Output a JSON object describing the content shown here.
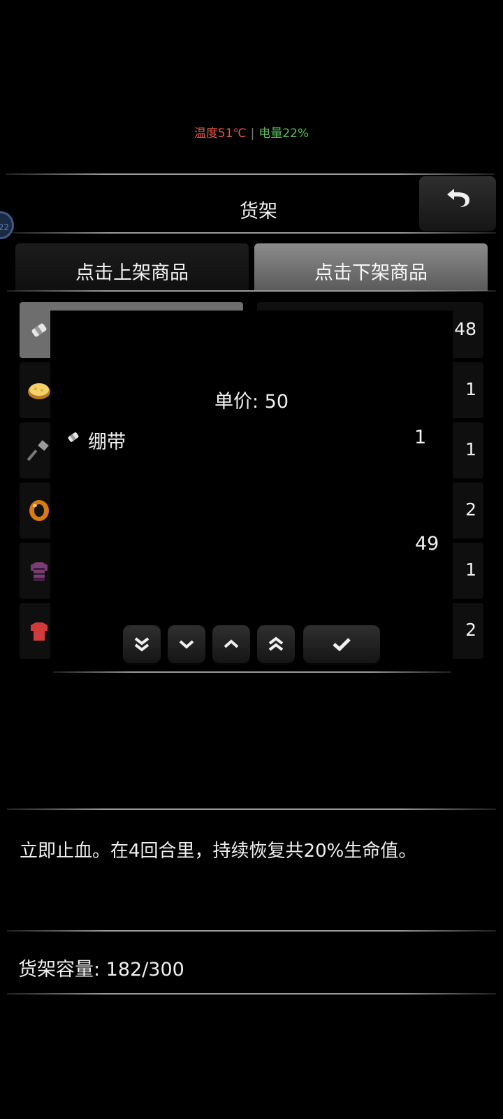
{
  "status": {
    "temperature": "温度51℃",
    "battery": "电量22%"
  },
  "header": {
    "title": "货架",
    "back_icon": "undo-arrow-icon"
  },
  "floating_badge": "22",
  "tabs": [
    {
      "label": "点击上架商品",
      "active": false
    },
    {
      "label": "点击下架商品",
      "active": true
    }
  ],
  "shelf_left_icons": [
    "bandage-icon",
    "pie-icon",
    "hammer-icon",
    "ring-icon",
    "striped-shirt-icon",
    "red-shirt-icon"
  ],
  "shelf_right_counts": [
    "48",
    "1",
    "1",
    "2",
    "1",
    "2"
  ],
  "dialog": {
    "price_label": "单价: 50",
    "item_name": "绷带",
    "item_quantity": "1",
    "stock_total": "49",
    "buttons": [
      "decrease-max-icon",
      "decrease-icon",
      "increase-icon",
      "increase-max-icon",
      "confirm-check-icon"
    ]
  },
  "description": "立即止血。在4回合里，持续恢复共20%生命值。",
  "capacity": "货架容量: 182/300",
  "colors": {
    "temperature": "#e0574b",
    "battery": "#58c25a",
    "active_tab": "#7a7a7a",
    "background": "#000000"
  }
}
